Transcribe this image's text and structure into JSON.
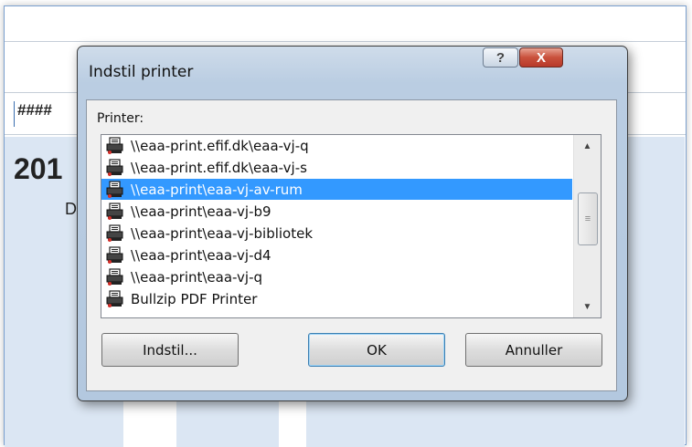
{
  "background": {
    "hash_text": "####",
    "year_text": "201",
    "letter_text": "D"
  },
  "dialog": {
    "title": "Indstil printer",
    "help_label": "?",
    "close_label": "X",
    "printer_label": "Printer:",
    "printers": [
      "\\\\eaa-print.efif.dk\\eaa-vj-q",
      "\\\\eaa-print.efif.dk\\eaa-vj-s",
      "\\\\eaa-print\\eaa-vj-av-rum",
      "\\\\eaa-print\\eaa-vj-b9",
      "\\\\eaa-print\\eaa-vj-bibliotek",
      "\\\\eaa-print\\eaa-vj-d4",
      "\\\\eaa-print\\eaa-vj-q",
      "Bullzip PDF Printer"
    ],
    "selected_index": 2,
    "buttons": {
      "setup": "Indstil...",
      "ok": "OK",
      "cancel": "Annuller"
    }
  },
  "icons": {
    "printer": "printer-icon",
    "scroll_up": "scroll-up-arrow-icon",
    "scroll_down": "scroll-down-arrow-icon",
    "scroll_thumb": "scroll-thumb-grip-icon"
  }
}
